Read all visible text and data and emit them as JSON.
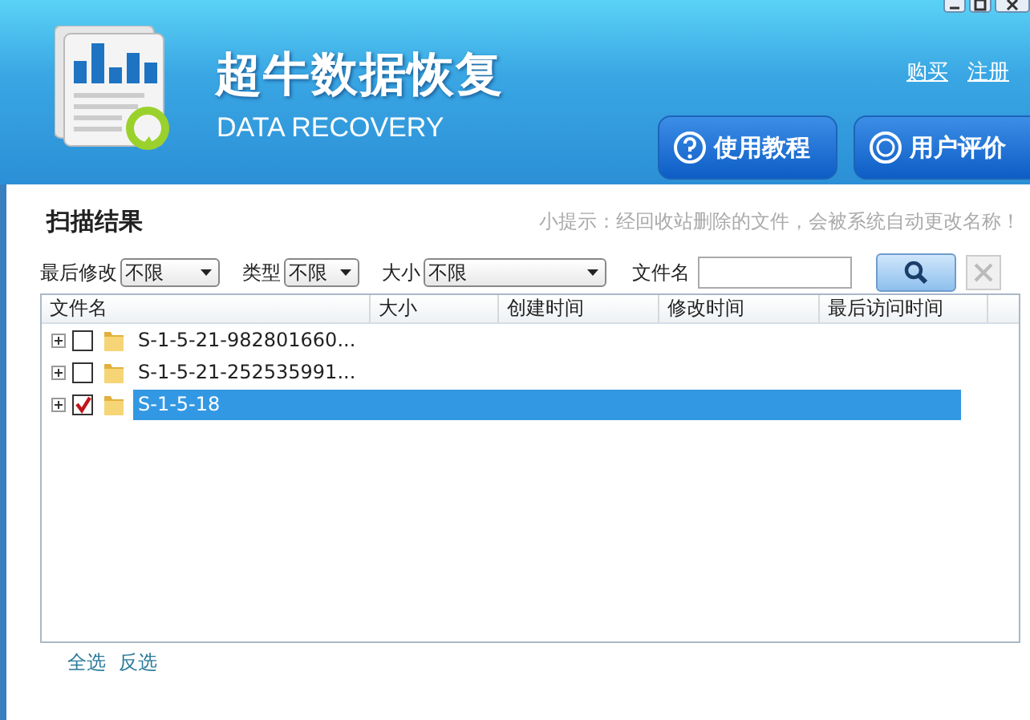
{
  "header": {
    "title": "超牛数据恢复",
    "subtitle": "DATA RECOVERY",
    "links": [
      "购买",
      "注册"
    ],
    "buttons": [
      {
        "label": "使用教程",
        "kind": "help"
      },
      {
        "label": "用户评价",
        "kind": "review"
      }
    ]
  },
  "section_title": "扫描结果",
  "hint": "小提示：经回收站删除的文件，会被系统自动更改名称！",
  "filters": [
    {
      "label": "最后修改",
      "value": "不限",
      "kind": "short"
    },
    {
      "label": "类型",
      "value": "不限",
      "kind": "tiny"
    },
    {
      "label": "大小",
      "value": "不限",
      "kind": "long"
    }
  ],
  "filename_label": "文件名",
  "table": {
    "columns": [
      "文件名",
      "大小",
      "创建时间",
      "修改时间",
      "最后访问时间"
    ],
    "rows": [
      {
        "name": "S-1-5-21-982801660...",
        "checked": false,
        "selected": false
      },
      {
        "name": "S-1-5-21-252535991...",
        "checked": false,
        "selected": false
      },
      {
        "name": "S-1-5-18",
        "checked": true,
        "selected": true
      }
    ]
  },
  "footer_links": [
    "全选",
    "反选"
  ]
}
